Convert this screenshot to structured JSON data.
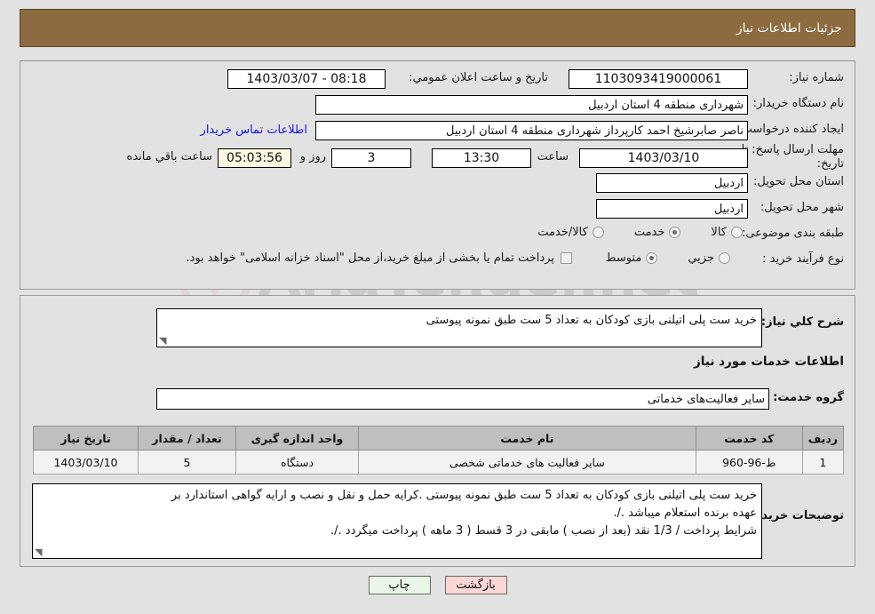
{
  "window": {
    "title": "جزئیات اطلاعات نیاز"
  },
  "watermark": {
    "text": "AriaTender.net"
  },
  "form": {
    "need_number_label": "شماره نیاز:",
    "need_number_value": "1103093419000061",
    "public_announce_label": "تاریخ و ساعت اعلان عمومي:",
    "public_announce_value": "1403/03/07 - 08:18",
    "buyer_org_label": "نام دستگاه خریدار:",
    "buyer_org_value": "شهرداری منطقه 4 استان اردبیل",
    "requester_label": "ایجاد کننده درخواست:",
    "requester_value": "ناصر صابرشیخ احمد کارپرداز شهرداری منطقه 4 استان اردبیل",
    "buyer_contact_link": "اطلاعات تماس خریدار",
    "deadline_label_line1": "مهلت ارسال پاسخ: تا",
    "deadline_label_line2": "تاریخ:",
    "deadline_date": "1403/03/10",
    "time_label": "ساعت",
    "deadline_time": "13:30",
    "days_value": "3",
    "days_label": "روز و",
    "countdown_value": "05:03:56",
    "countdown_label": "ساعت باقي مانده",
    "delivery_province_label": "استان محل تحویل:",
    "delivery_province_value": "اردبیل",
    "delivery_city_label": "شهر محل تحویل:",
    "delivery_city_value": "اردبیل",
    "category_label": "طبقه بندی موضوعی:",
    "category_options": [
      {
        "label": "کالا",
        "selected": false
      },
      {
        "label": "خدمت",
        "selected": true
      },
      {
        "label": "کالا/خدمت",
        "selected": false
      }
    ],
    "process_type_label": "نوع فرآیند خرید :",
    "process_type_options": [
      {
        "label": "جزیي",
        "selected": false
      },
      {
        "label": "متوسط",
        "selected": true
      }
    ],
    "treasury_checkbox_label": "پرداخت تمام یا بخشی از مبلغ خرید،از محل \"اسناد خزانه اسلامی\" خواهد بود.",
    "treasury_checked": false
  },
  "summary": {
    "label": "شرح كلي نیاز:",
    "value": "خرید ست پلی اتیلنی بازی کودکان به تعداد 5 ست طبق نمونه پیوستی"
  },
  "services": {
    "section_title": "اطلاعات خدمات مورد نیاز",
    "group_label": "گروه خدمت:",
    "group_value": "سایر فعالیت‌های خدماتی",
    "columns": [
      "ردیف",
      "کد خدمت",
      "نام خدمت",
      "واحد اندازه گیری",
      "تعداد / مقدار",
      "تاریخ نیاز"
    ],
    "rows": [
      {
        "index": "1",
        "code": "ط-96-960",
        "name": "سایر فعالیت های خدماتی شخصی",
        "unit": "دستگاه",
        "quantity": "5",
        "need_date": "1403/03/10"
      }
    ]
  },
  "buyer_notes": {
    "label": "توضیحات خریدار:",
    "line1": "خرید ست پلی اتیلنی بازی کودکان به تعداد 5 ست طبق نمونه پیوستی .کرایه حمل و نقل و نصب و ارایه گواهی استاندارد بر",
    "line2": "عهده برنده استعلام میباشد ./.",
    "line3": "شرایط پرداخت / 1/3 نقد (بعد از نصب ) مابقی در 3 قسط ( 3 ماهه ) پرداخت میگردد ./."
  },
  "footer": {
    "print_label": "چاپ",
    "back_label": "بازگشت"
  },
  "colors": {
    "header_brown": "#8b6b3f",
    "link_blue": "#1515d8",
    "countdown_bg": "#fbf8e3",
    "table_header_bg": "#bfbfbf",
    "print_btn_bg": "#e9f7e9",
    "back_btn_bg": "#fbd6d6"
  }
}
